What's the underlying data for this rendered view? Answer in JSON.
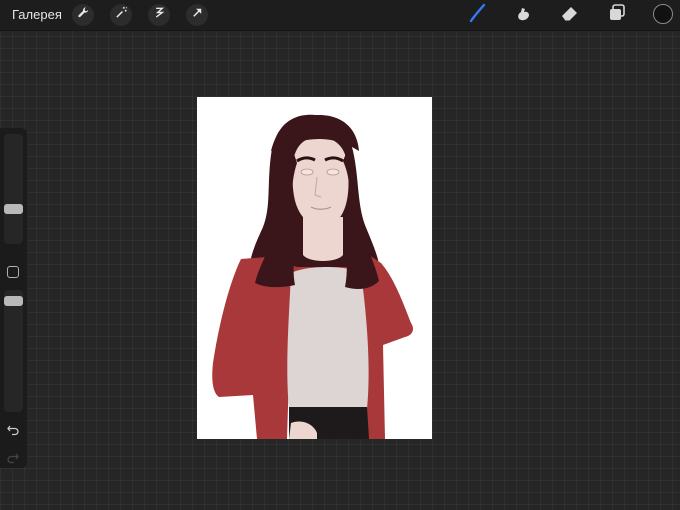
{
  "toolbar": {
    "gallery_label": "Галерея",
    "left_tools": [
      {
        "icon": "wrench-icon"
      },
      {
        "icon": "magic-wand-icon"
      },
      {
        "icon": "selection-icon"
      },
      {
        "icon": "transform-arrow-icon"
      }
    ],
    "right_tools": [
      {
        "icon": "brush-icon",
        "active": true
      },
      {
        "icon": "smudge-icon"
      },
      {
        "icon": "eraser-icon"
      },
      {
        "icon": "layers-icon"
      }
    ],
    "current_color": "#111111",
    "accent_color": "#2f7cf6"
  },
  "sidebar": {
    "brush_size_level": 0.3,
    "opacity_level": 0.95
  },
  "artwork": {
    "hair_color": "#3a1519",
    "jacket_color": "#a8383a",
    "shirt_color": "#ddd4d4",
    "skin_color": "#ecd6cf",
    "pants_color": "#1e1a1b"
  }
}
